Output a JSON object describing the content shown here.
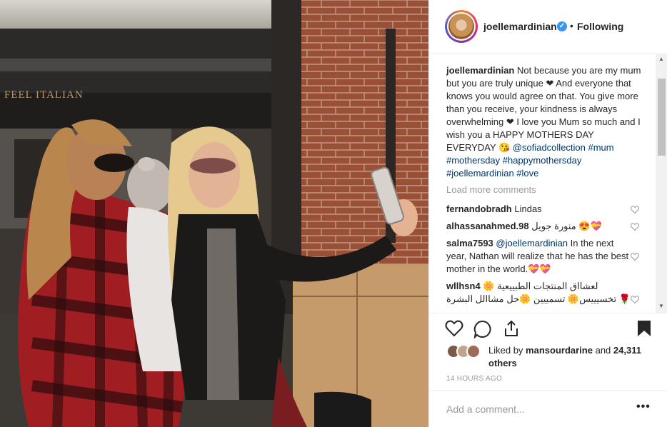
{
  "photo": {
    "alt": "",
    "sign_text": "FEEL ITALIAN"
  },
  "header": {
    "username": "joellemardinian",
    "verified_icon": "verified-badge-icon",
    "separator": "•",
    "follow_status": "Following"
  },
  "caption": {
    "username": "joellemardinian",
    "text_1": "Not because you are my mum but you are truly unique ❤ And everyone that knows you would agree on that. You give more than you receive, your kindness is always overwhelming ❤ I love you Mum so much and I wish you a HAPPY MOTHERS DAY EVERYDAY 😘",
    "tags": "@sofiadcollection #mum #mothersday #happymothersday #joellemardinian #love"
  },
  "load_more": "Load more comments",
  "comments": [
    {
      "username": "fernandobradh",
      "text": "Lindas"
    },
    {
      "username": "alhassanahmed.98",
      "text": "منورة جويل 😍💝"
    },
    {
      "username": "salma7593",
      "mention": "@joellemardinian",
      "text": "In the next year, Nathan will realize that he has the best mother in the world.💝💝"
    },
    {
      "username": "wllhsn4",
      "text": "لعشااق المنتجات الطبييعية 🌼 تخسيييس🌼 تسمييين 🌼حل مشاالل البشرة 🌹"
    }
  ],
  "actions": {
    "like_icon": "heart-icon",
    "comment_icon": "comment-icon",
    "share_icon": "share-icon",
    "save_icon": "bookmark-icon"
  },
  "likes": {
    "prefix": "Liked by",
    "user": "mansourdarine",
    "joiner": "and",
    "count_text": "24,311 others"
  },
  "timestamp": "14 HOURS AGO",
  "add_comment": {
    "placeholder": "Add a comment...",
    "more_label": "•••"
  },
  "colors": {
    "link": "#003569",
    "muted": "#999999",
    "verified": "#3897f0",
    "border": "#efefef"
  }
}
